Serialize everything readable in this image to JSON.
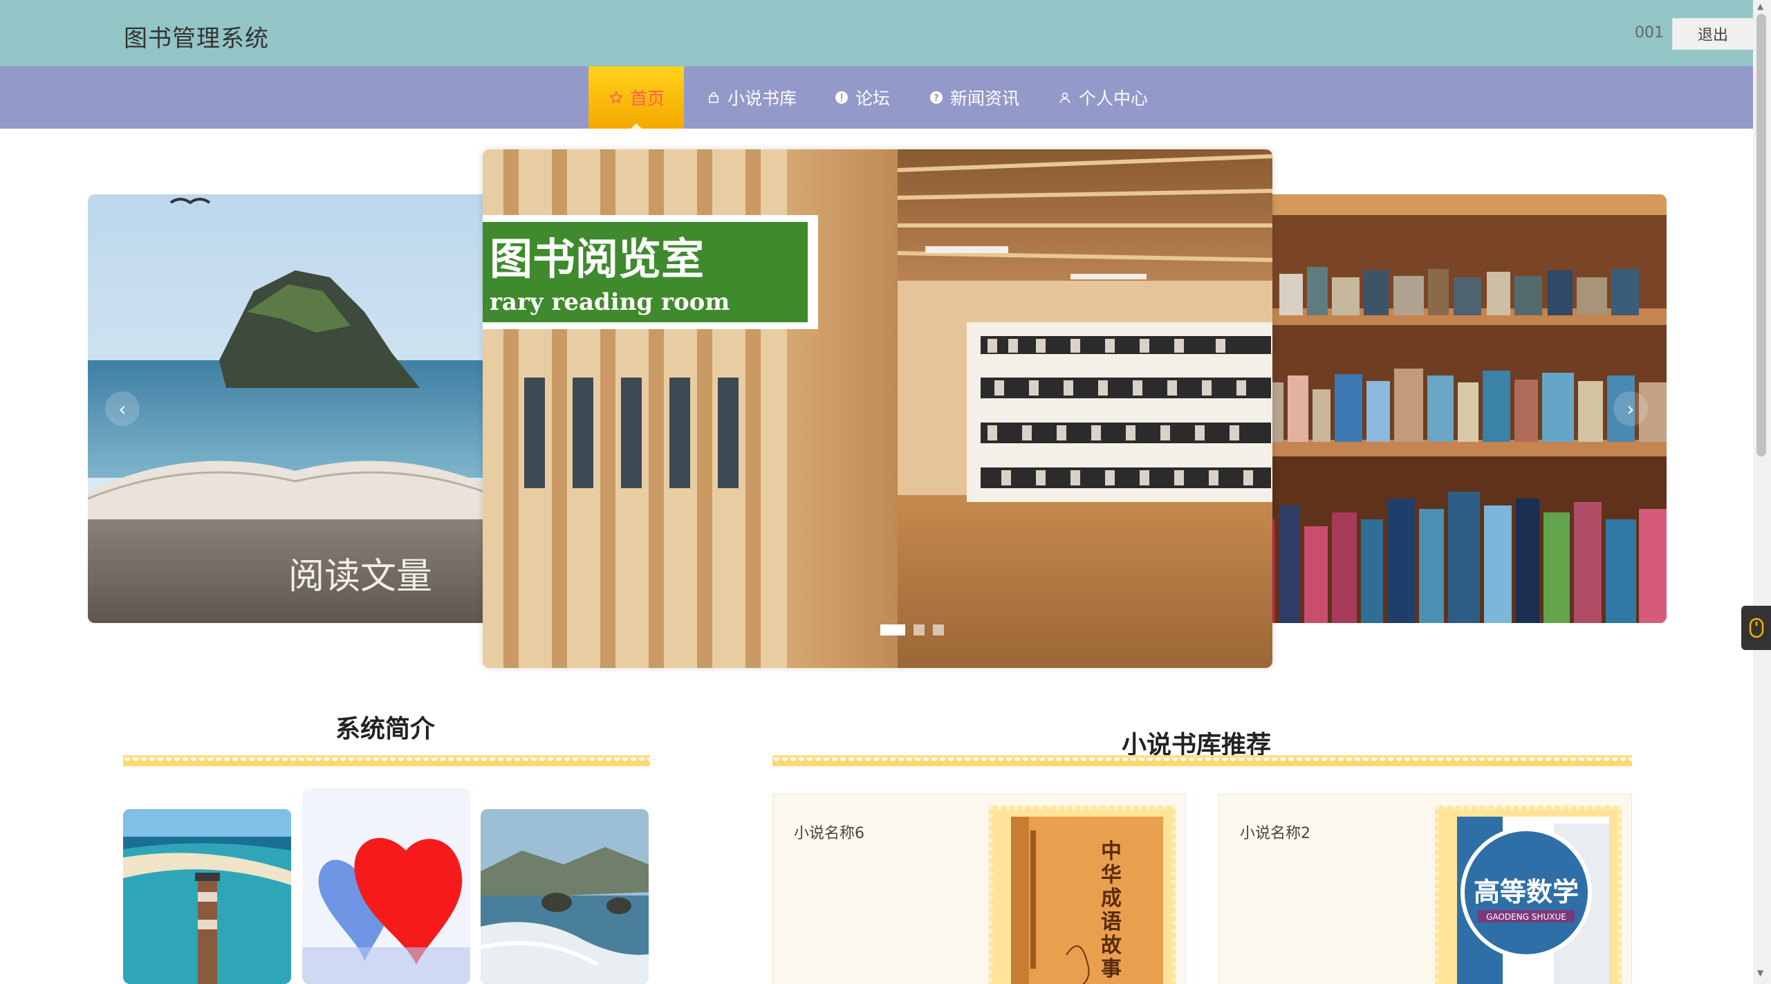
{
  "header": {
    "title": "图书管理系统",
    "username": "001",
    "logout_label": "退出"
  },
  "nav": {
    "items": [
      {
        "label": "首页",
        "icon": "star-icon",
        "active": true
      },
      {
        "label": "小说书库",
        "icon": "bag-icon",
        "active": false
      },
      {
        "label": "论坛",
        "icon": "info-icon",
        "active": false
      },
      {
        "label": "新闻资讯",
        "icon": "question-icon",
        "active": false
      },
      {
        "label": "个人中心",
        "icon": "user-icon",
        "active": false
      }
    ]
  },
  "carousel": {
    "slides": [
      {
        "caption": "阅读文量"
      },
      {
        "sign_title": "图书阅览室",
        "sign_subtitle": "rary reading room"
      },
      {
        "caption": ""
      }
    ],
    "prev_label": "‹",
    "next_label": "›",
    "active_index": 0,
    "dot_count": 3
  },
  "intro": {
    "title": "系统简介"
  },
  "recommend": {
    "title": "小说书库推荐",
    "books": [
      {
        "name": "小说名称6",
        "cover_title": "中华成语故事"
      },
      {
        "name": "小说名称2",
        "cover_title": "高等数学",
        "cover_subtitle": "GAODENG SHUXUE"
      }
    ]
  },
  "colors": {
    "header_bg": "#93c5c6",
    "nav_bg": "#9399c8",
    "nav_active": "#ffc414",
    "accent_wave": "#ffd86b"
  }
}
